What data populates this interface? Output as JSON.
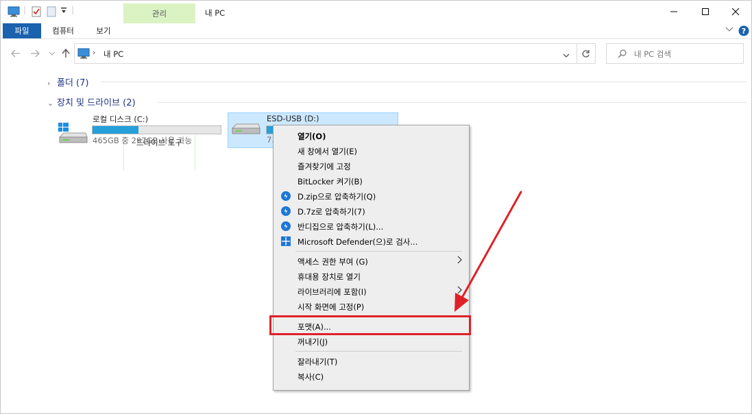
{
  "window": {
    "title": "내 PC",
    "context_tab": "관리"
  },
  "ribbon": {
    "tabs": [
      "파일",
      "컴퓨터",
      "보기",
      "드라이브 도구"
    ]
  },
  "address": {
    "path": "내 PC",
    "search_placeholder": "내 PC 검색"
  },
  "groups": {
    "folders": "폴더 (7)",
    "devices": "장치 및 드라이브 (2)"
  },
  "drives": [
    {
      "name": "로컬 디스크 (C:)",
      "usage_fraction": 0.36,
      "space_text": "465GB 중 297GB 사용 가능"
    },
    {
      "name": "ESD-USB (D:)",
      "usage_fraction": 0.2,
      "space_text": "7."
    }
  ],
  "context_menu": {
    "items": [
      {
        "label": "열기(O)"
      },
      {
        "label": "새 창에서 열기(E)"
      },
      {
        "label": "즐겨찾기에 고정"
      },
      {
        "label": "BitLocker 켜기(B)"
      },
      {
        "label": "D.zip으로 압축하기(Q)",
        "icon": "bandizip-icon"
      },
      {
        "label": "D.7z로 압축하기(7)",
        "icon": "bandizip-icon"
      },
      {
        "label": "반디집으로 압축하기(L)...",
        "icon": "bandizip-icon"
      },
      {
        "label": "Microsoft Defender(으)로 검사...",
        "icon": "defender-icon"
      },
      {
        "label": "액세스 권한 부여 (G)"
      },
      {
        "label": "휴대용 장치로 열기"
      },
      {
        "label": "라이브러리에 포함(I)"
      },
      {
        "label": "시작 화면에 고정(P)"
      },
      {
        "label": "포맷(A)..."
      },
      {
        "label": "꺼내기(J)"
      },
      {
        "label": "잘라내기(T)"
      },
      {
        "label": "복사(C)"
      }
    ]
  },
  "colors": {
    "accent": "#1a61ae",
    "selection": "#cce8ff",
    "annotation": "#e02027",
    "progress": "#26a0da"
  }
}
